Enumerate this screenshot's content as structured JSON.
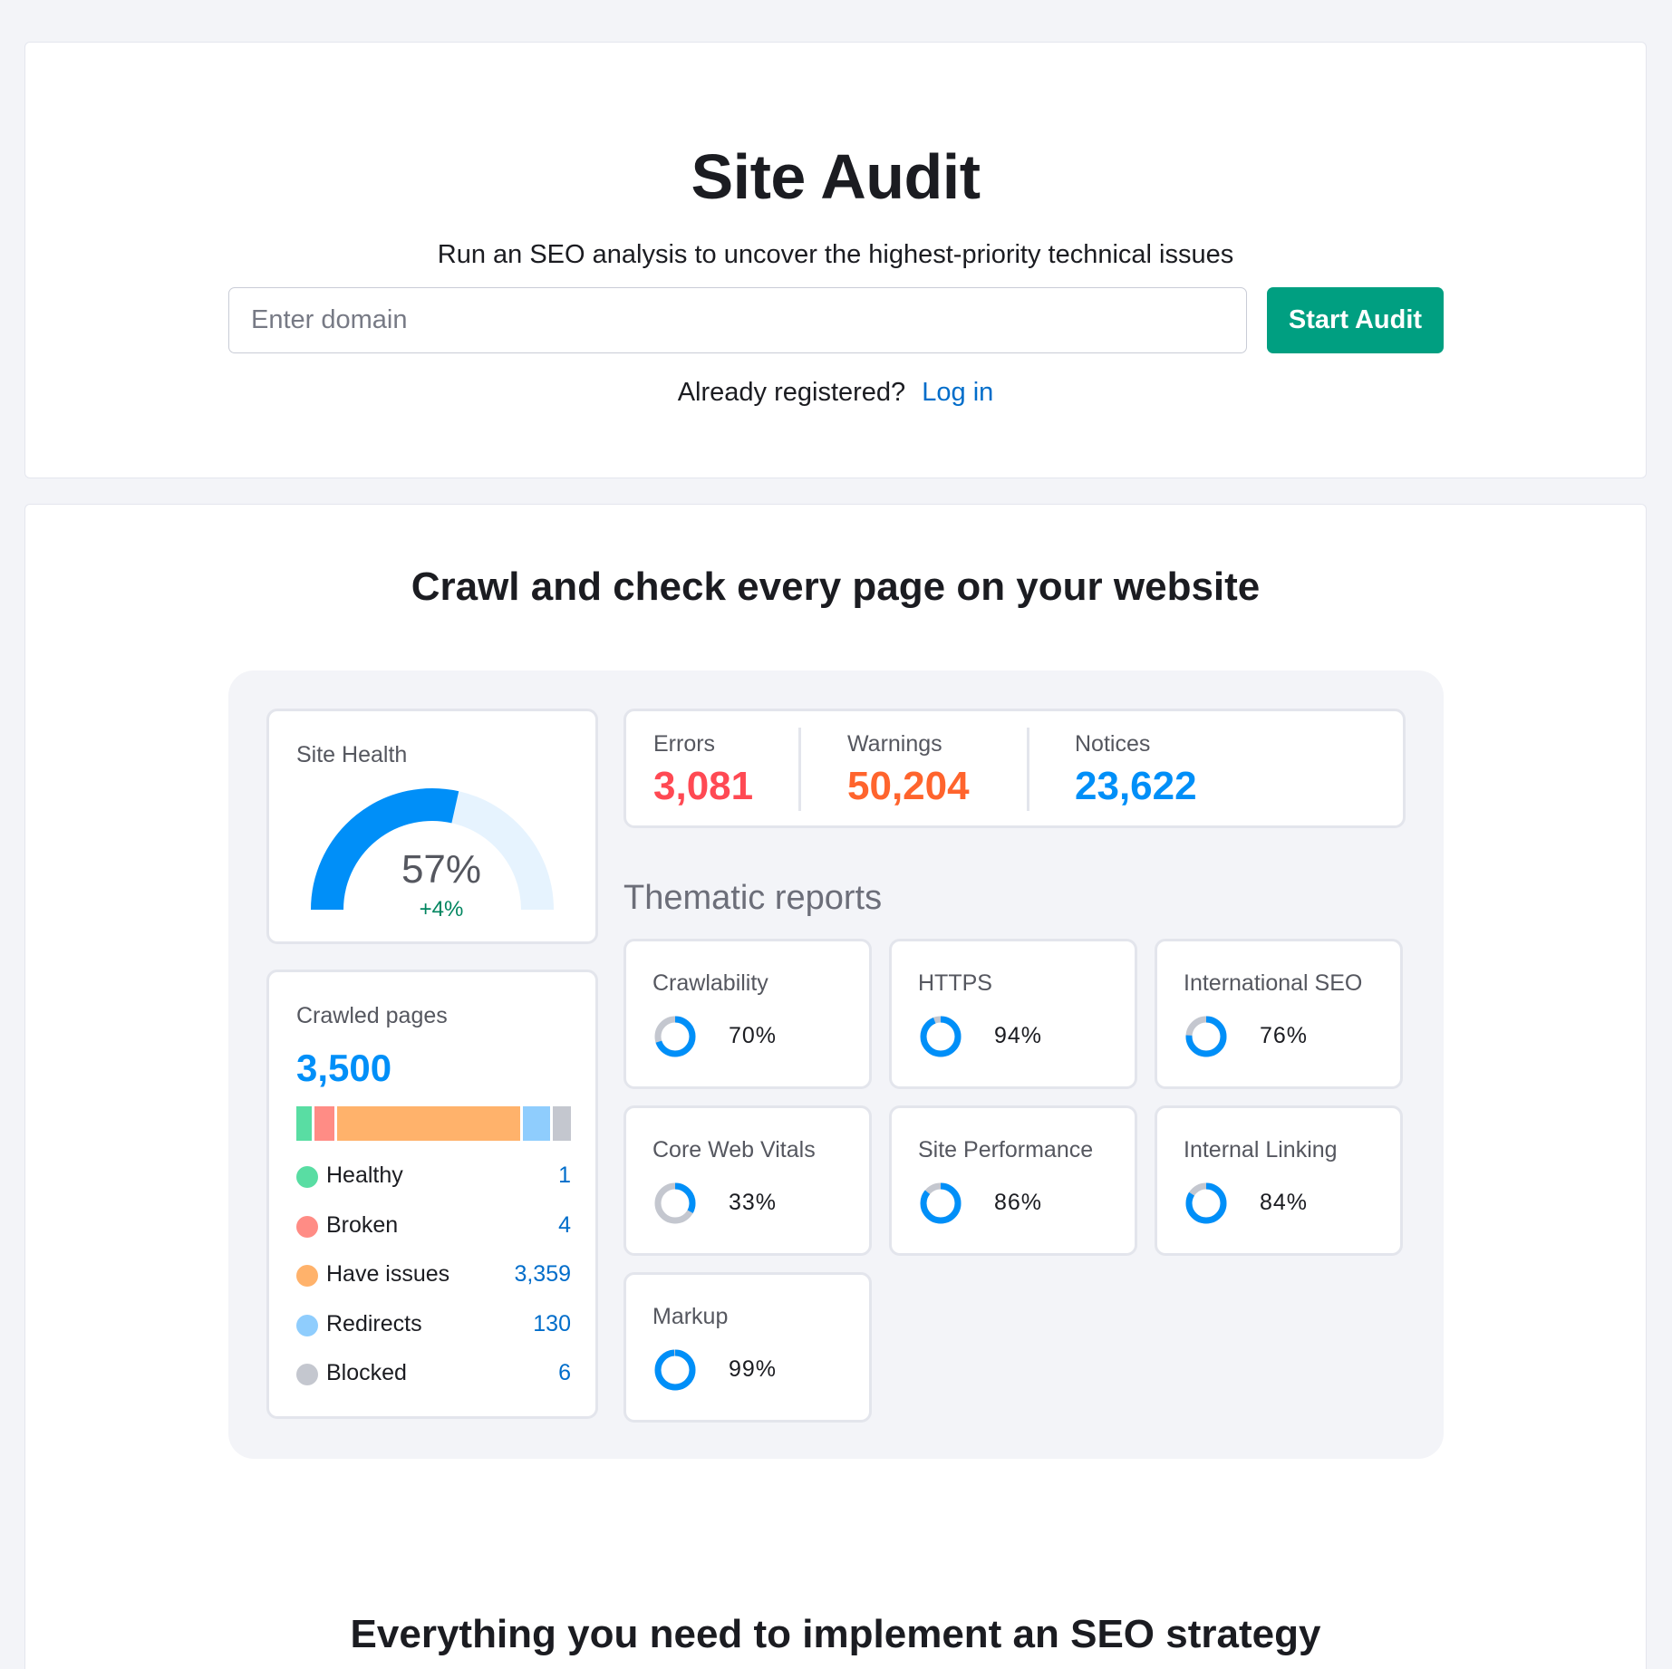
{
  "hero": {
    "title": "Site Audit",
    "subtitle": "Run an SEO analysis to uncover the highest-priority technical issues",
    "domain_placeholder": "Enter domain",
    "domain_value": "",
    "start_button": "Start Audit",
    "registered_text": "Already registered?",
    "login_link": "Log in"
  },
  "features": {
    "title": "Crawl and check every page on your website",
    "bottom_title": "Everything you need to implement an SEO strategy"
  },
  "site_health": {
    "label": "Site Health",
    "percent": 57,
    "percent_text": "57%",
    "delta_text": "+4%",
    "fill_color": "#008ff8",
    "track_color": "#e6f3fe"
  },
  "crawled": {
    "label": "Crawled pages",
    "total": "3,500",
    "items": [
      {
        "label": "Healthy",
        "value": "1",
        "color": "#59dda3",
        "weight": 1
      },
      {
        "label": "Broken",
        "value": "4",
        "color": "#ff8c85",
        "weight": 1.3
      },
      {
        "label": "Have issues",
        "value": "3,359",
        "color": "#ffb26b",
        "weight": 12
      },
      {
        "label": "Redirects",
        "value": "130",
        "color": "#8fcdfd",
        "weight": 1.8
      },
      {
        "label": "Blocked",
        "value": "6",
        "color": "#c4c7cf",
        "weight": 1.2
      }
    ]
  },
  "issues": [
    {
      "label": "Errors",
      "value": "3,081",
      "color": "#ff4953"
    },
    {
      "label": "Warnings",
      "value": "50,204",
      "color": "#ff642d"
    },
    {
      "label": "Notices",
      "value": "23,622",
      "color": "#008ff8"
    }
  ],
  "thematic": {
    "title": "Thematic reports",
    "ring_color": "#008ff8",
    "ring_track": "#c4c7cf",
    "reports": [
      {
        "label": "Crawlability",
        "value": "70%",
        "percent": 70
      },
      {
        "label": "HTTPS",
        "value": "94%",
        "percent": 94
      },
      {
        "label": "International SEO",
        "value": "76%",
        "percent": 76
      },
      {
        "label": "Core Web Vitals",
        "value": "33%",
        "percent": 33
      },
      {
        "label": "Site Performance",
        "value": "86%",
        "percent": 86
      },
      {
        "label": "Internal Linking",
        "value": "84%",
        "percent": 84
      },
      {
        "label": "Markup",
        "value": "99%",
        "percent": 99
      }
    ]
  }
}
